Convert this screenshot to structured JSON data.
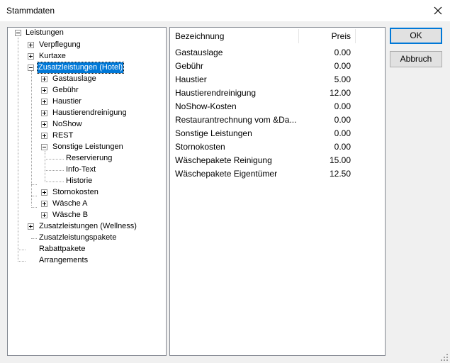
{
  "window": {
    "title": "Stammdaten",
    "close_glyph": "✕"
  },
  "tree": {
    "root": "Leistungen",
    "items": [
      "Verpflegung",
      "Kurtaxe",
      "Zusatzleistungen (Hotel)",
      "Gastauslage",
      "Gebühr",
      "Haustier",
      "Haustierendreinigung",
      "NoShow",
      "REST",
      "Sonstige Leistungen",
      "Reservierung",
      "Info-Text",
      "Historie",
      "Stornokosten",
      "Wäsche A",
      "Wäsche B",
      "Zusatzleistungen (Wellness)",
      "Zusatzleistungspakete",
      "Rabattpakete",
      "Arrangements"
    ]
  },
  "grid": {
    "columns": [
      "Bezeichnung",
      "Preis"
    ],
    "rows": [
      [
        "Gastauslage",
        "0.00"
      ],
      [
        "Gebühr",
        "0.00"
      ],
      [
        "Haustier",
        "5.00"
      ],
      [
        "Haustierendreinigung",
        "12.00"
      ],
      [
        "NoShow-Kosten",
        "0.00"
      ],
      [
        "Restaurantrechnung vom &Da...",
        "0.00"
      ],
      [
        "Sonstige Leistungen",
        "0.00"
      ],
      [
        "Stornokosten",
        "0.00"
      ],
      [
        "Wäschepakete Reinigung",
        "15.00"
      ],
      [
        "Wäschepakete Eigentümer",
        "12.50"
      ]
    ]
  },
  "buttons": {
    "ok": "OK",
    "cancel": "Abbruch"
  },
  "colors": {
    "selection": "#0078d7",
    "default_button_border": "#0078d7"
  }
}
